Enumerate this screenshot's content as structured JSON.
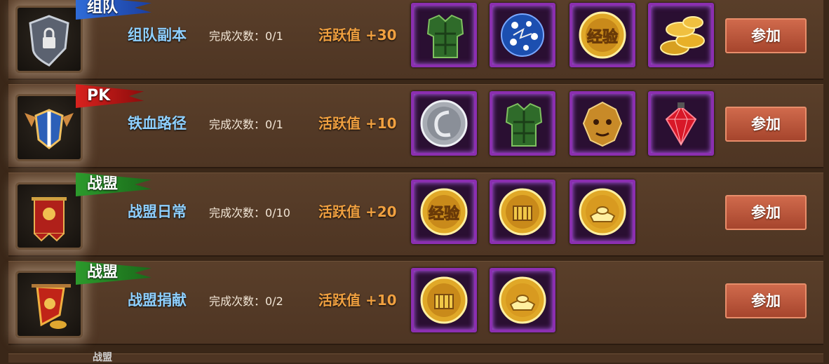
{
  "activities": [
    {
      "tag": "组队",
      "tag_color": "blue",
      "emblem_icon": "shield-lock-icon",
      "name": "组队副本",
      "completion_label": "完成次数：0/1",
      "activity_label": "活跃值 +30",
      "rewards": [
        "green-armor-icon",
        "blue-dotted-egg-icon",
        "exp-coin-icon",
        "gold-coins-pile-icon"
      ],
      "button_label": "参加"
    },
    {
      "tag": "PK",
      "tag_color": "red",
      "emblem_icon": "winged-shield-icon",
      "name": "铁血路径",
      "completion_label": "完成次数：0/1",
      "activity_label": "活跃值 +10",
      "rewards": [
        "silver-coin-icon",
        "green-armor-icon",
        "golden-lion-mask-icon",
        "red-gem-icon"
      ],
      "button_label": "参加"
    },
    {
      "tag": "战盟",
      "tag_color": "green",
      "emblem_icon": "red-banner-icon",
      "name": "战盟日常",
      "completion_label": "完成次数：0/10",
      "activity_label": "活跃值 +20",
      "rewards": [
        "exp-coin-icon",
        "gold-fist-coin-icon",
        "gold-ingot-coin-icon"
      ],
      "button_label": "参加"
    },
    {
      "tag": "战盟",
      "tag_color": "green",
      "emblem_icon": "red-flag-gold-icon",
      "name": "战盟捐献",
      "completion_label": "完成次数：0/2",
      "activity_label": "活跃值 +10",
      "rewards": [
        "gold-fist-coin-icon",
        "gold-ingot-coin-icon"
      ],
      "button_label": "参加"
    }
  ],
  "exp_label": "经验",
  "next_row_tag": "战盟",
  "colors": {
    "reward_border": "#8b2fb0",
    "button": "#b8523a",
    "name_text": "#8fd0ff",
    "activity_text": "#f0a040"
  }
}
